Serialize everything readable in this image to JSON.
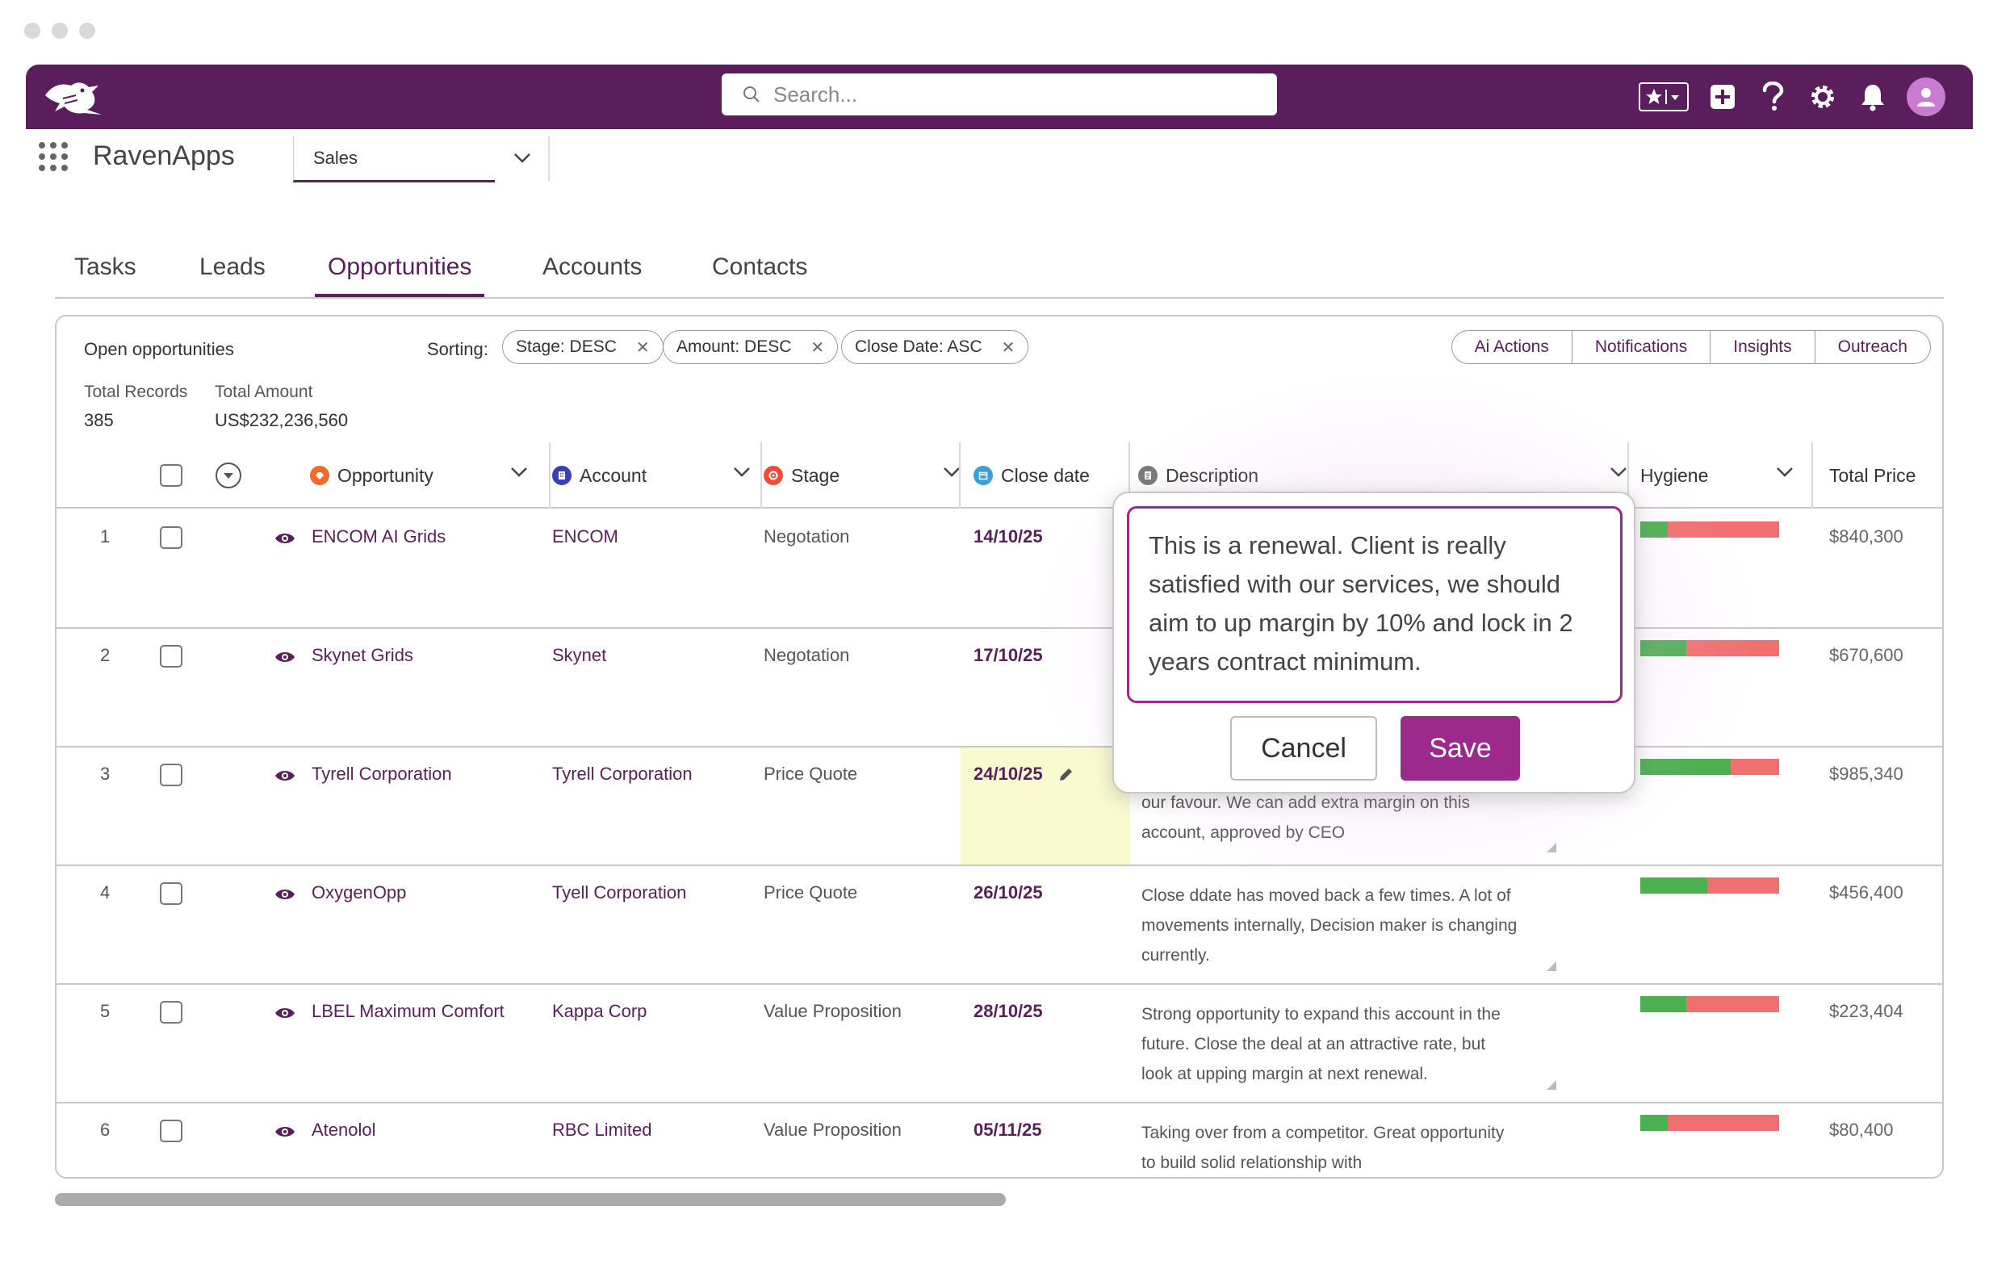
{
  "header": {
    "search_placeholder": "Search...",
    "icons": [
      "raven-logo-icon",
      "favorites-icon",
      "add-icon",
      "help-icon",
      "settings-icon",
      "notifications-bell-icon",
      "user-avatar-icon"
    ]
  },
  "appbar": {
    "app_name": "RavenApps",
    "module": "Sales"
  },
  "tabs": [
    "Tasks",
    "Leads",
    "Opportunities",
    "Accounts",
    "Contacts"
  ],
  "active_tab": "Opportunities",
  "panel": {
    "title": "Open opportunities",
    "sorting_label": "Sorting:",
    "chips": [
      "Stage: DESC",
      "Amount: DESC",
      "Close Date: ASC"
    ],
    "actions": [
      "Ai Actions",
      "Notifications",
      "Insights",
      "Outreach"
    ],
    "total_records_label": "Total Records",
    "total_records": "385",
    "total_amount_label": "Total Amount",
    "total_amount": "US$232,236,560"
  },
  "columns": {
    "opportunity": "Opportunity",
    "account": "Account",
    "stage": "Stage",
    "close_date": "Close date",
    "description": "Description",
    "hygiene": "Hygiene",
    "total_price": "Total Price"
  },
  "rows": [
    {
      "num": "1",
      "opportunity": "ENCOM AI Grids",
      "account": "ENCOM",
      "stage": "Negotation",
      "close_date": "14/10/25",
      "description": "",
      "hygiene_good": 0.2,
      "price": "$840,300"
    },
    {
      "num": "2",
      "opportunity": "Skynet Grids",
      "account": "Skynet",
      "stage": "Negotation",
      "close_date": "17/10/25",
      "description": "",
      "hygiene_good": 0.33,
      "price": "$670,600"
    },
    {
      "num": "3",
      "opportunity": "Tyrell Corporation",
      "account": "Tyrell Corporation",
      "stage": "Price Quote",
      "close_date": "24/10/25",
      "description": "our favour. We can add extra margin on this account, approved by CEO",
      "hygiene_good": 0.65,
      "price": "$985,340"
    },
    {
      "num": "4",
      "opportunity": "OxygenOpp",
      "account": "Tyell Corporation",
      "stage": "Price Quote",
      "close_date": "26/10/25",
      "description": "Close ddate has moved back a few times. A lot of movements internally, Decision maker is changing currently.",
      "hygiene_good": 0.48,
      "price": "$456,400"
    },
    {
      "num": "5",
      "opportunity": "LBEL Maximum Comfort",
      "account": "Kappa Corp",
      "stage": "Value Proposition",
      "close_date": "28/10/25",
      "description": "Strong opportunity to expand this account in the future. Close the deal at an attractive rate, but look at upping margin at next renewal.",
      "hygiene_good": 0.33,
      "price": "$223,404"
    },
    {
      "num": "6",
      "opportunity": "Atenolol",
      "account": "RBC Limited",
      "stage": "Value Proposition",
      "close_date": "05/11/25",
      "description": "Taking over from a competitor. Great opportunity to build solid relationship with",
      "hygiene_good": 0.2,
      "price": "$80,400"
    }
  ],
  "editor": {
    "text": "This is a renewal. Client is really satisfied with our services, we should aim to up margin by 10% and lock in 2 years contract minimum.",
    "cancel_label": "Cancel",
    "save_label": "Save"
  },
  "colors": {
    "brand": "#5a1e5c",
    "accent": "#9c2a8c",
    "hygiene_good": "#4caf50",
    "hygiene_bad": "#f07070"
  }
}
